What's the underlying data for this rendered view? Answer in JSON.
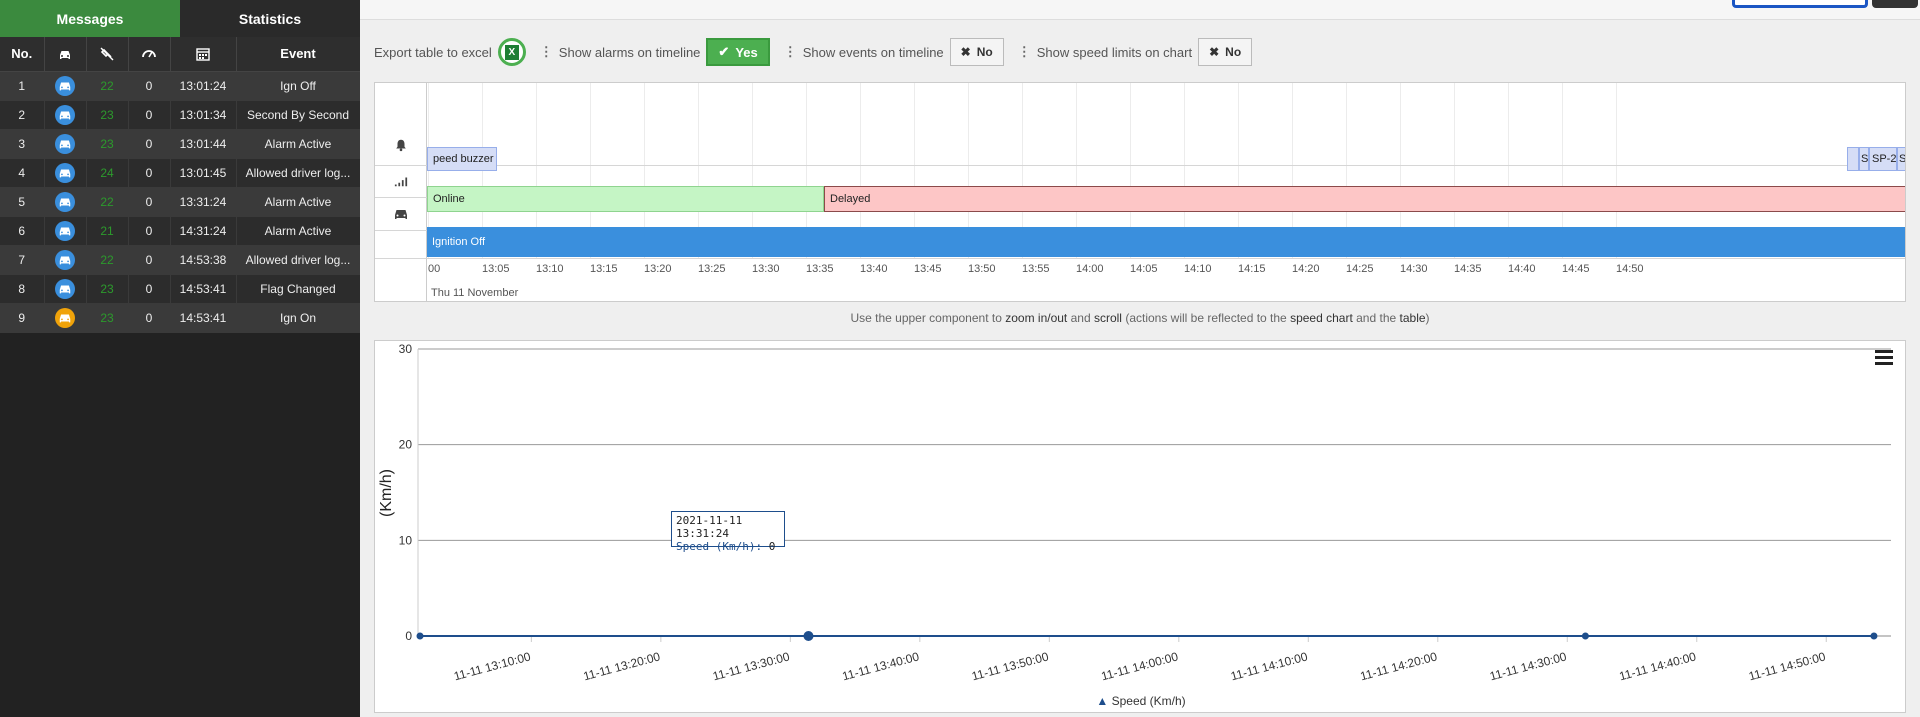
{
  "tabs": {
    "messages": "Messages",
    "statistics": "Statistics"
  },
  "table": {
    "headers": {
      "no": "No.",
      "event": "Event"
    },
    "header_icons": [
      "car-icon",
      "satellite-off-icon",
      "speedometer-icon",
      "calendar-icon"
    ],
    "rows": [
      {
        "no": "1",
        "icon": "car",
        "color": "#3a8fdd",
        "sat": "22",
        "speed": "0",
        "time": "13:01:24",
        "event": "Ign Off"
      },
      {
        "no": "2",
        "icon": "car",
        "color": "#3a8fdd",
        "sat": "23",
        "speed": "0",
        "time": "13:01:34",
        "event": "Second By Second"
      },
      {
        "no": "3",
        "icon": "car",
        "color": "#3a8fdd",
        "sat": "23",
        "speed": "0",
        "time": "13:01:44",
        "event": "Alarm Active"
      },
      {
        "no": "4",
        "icon": "car",
        "color": "#3a8fdd",
        "sat": "24",
        "speed": "0",
        "time": "13:01:45",
        "event": "Allowed driver log..."
      },
      {
        "no": "5",
        "icon": "car",
        "color": "#3a8fdd",
        "sat": "22",
        "speed": "0",
        "time": "13:31:24",
        "event": "Alarm Active"
      },
      {
        "no": "6",
        "icon": "car",
        "color": "#3a8fdd",
        "sat": "21",
        "speed": "0",
        "time": "14:31:24",
        "event": "Alarm Active"
      },
      {
        "no": "7",
        "icon": "car",
        "color": "#3a8fdd",
        "sat": "22",
        "speed": "0",
        "time": "14:53:38",
        "event": "Allowed driver log..."
      },
      {
        "no": "8",
        "icon": "car",
        "color": "#3a8fdd",
        "sat": "23",
        "speed": "0",
        "time": "14:53:41",
        "event": "Flag Changed"
      },
      {
        "no": "9",
        "icon": "car",
        "color": "#f0a30a",
        "sat": "23",
        "speed": "0",
        "time": "14:53:41",
        "event": "Ign On"
      }
    ]
  },
  "toolbar": {
    "export_label": "Export table to excel",
    "alarms_label": "Show alarms on timeline",
    "alarms_value": "Yes",
    "events_label": "Show events on timeline",
    "events_value": "No",
    "speed_limits_label": "Show speed limits on chart",
    "speed_limits_value": "No"
  },
  "timeline": {
    "ticks": [
      "00",
      "13:05",
      "13:10",
      "13:15",
      "13:20",
      "13:25",
      "13:30",
      "13:35",
      "13:40",
      "13:45",
      "13:50",
      "13:55",
      "14:00",
      "14:05",
      "14:10",
      "14:15",
      "14:20",
      "14:25",
      "14:30",
      "14:35",
      "14:40",
      "14:45",
      "14:50"
    ],
    "date": "Thu 11 November",
    "alarm_items": [
      "peed buzzer",
      "S",
      "SP-2",
      "S"
    ],
    "status_items": [
      "Online",
      "Delayed"
    ],
    "ignition_item": "Ignition Off"
  },
  "hint": {
    "p1": "Use the upper component to ",
    "zoom": "zoom in/out",
    "p2": " and ",
    "scroll": "scroll",
    "p3": " (actions will be reflected to the ",
    "speed_chart": "speed chart",
    "p4": " and the ",
    "table": "table",
    "p5": ")"
  },
  "tooltip": {
    "time": "2021-11-11 13:31:24",
    "series": "Speed (Km/h):",
    "value": "0"
  },
  "chart_data": {
    "type": "line",
    "ylabel": "(Km/h)",
    "ylim": [
      0,
      30
    ],
    "yticks": [
      "0",
      "10",
      "20",
      "30"
    ],
    "xticks": [
      "11-11 13:10:00",
      "11-11 13:20:00",
      "11-11 13:30:00",
      "11-11 13:40:00",
      "11-11 13:50:00",
      "11-11 14:00:00",
      "11-11 14:10:00",
      "11-11 14:20:00",
      "11-11 14:30:00",
      "11-11 14:40:00",
      "11-11 14:50:00"
    ],
    "series": [
      {
        "name": "Speed (Km/h)",
        "color": "#1e4e8c",
        "points": [
          {
            "t": "2021-11-11 13:01:24",
            "v": 0
          },
          {
            "t": "2021-11-11 13:31:24",
            "v": 0
          },
          {
            "t": "2021-11-11 14:31:24",
            "v": 0
          },
          {
            "t": "2021-11-11 14:53:41",
            "v": 0
          }
        ]
      }
    ],
    "legend": "Speed (Km/h)"
  }
}
